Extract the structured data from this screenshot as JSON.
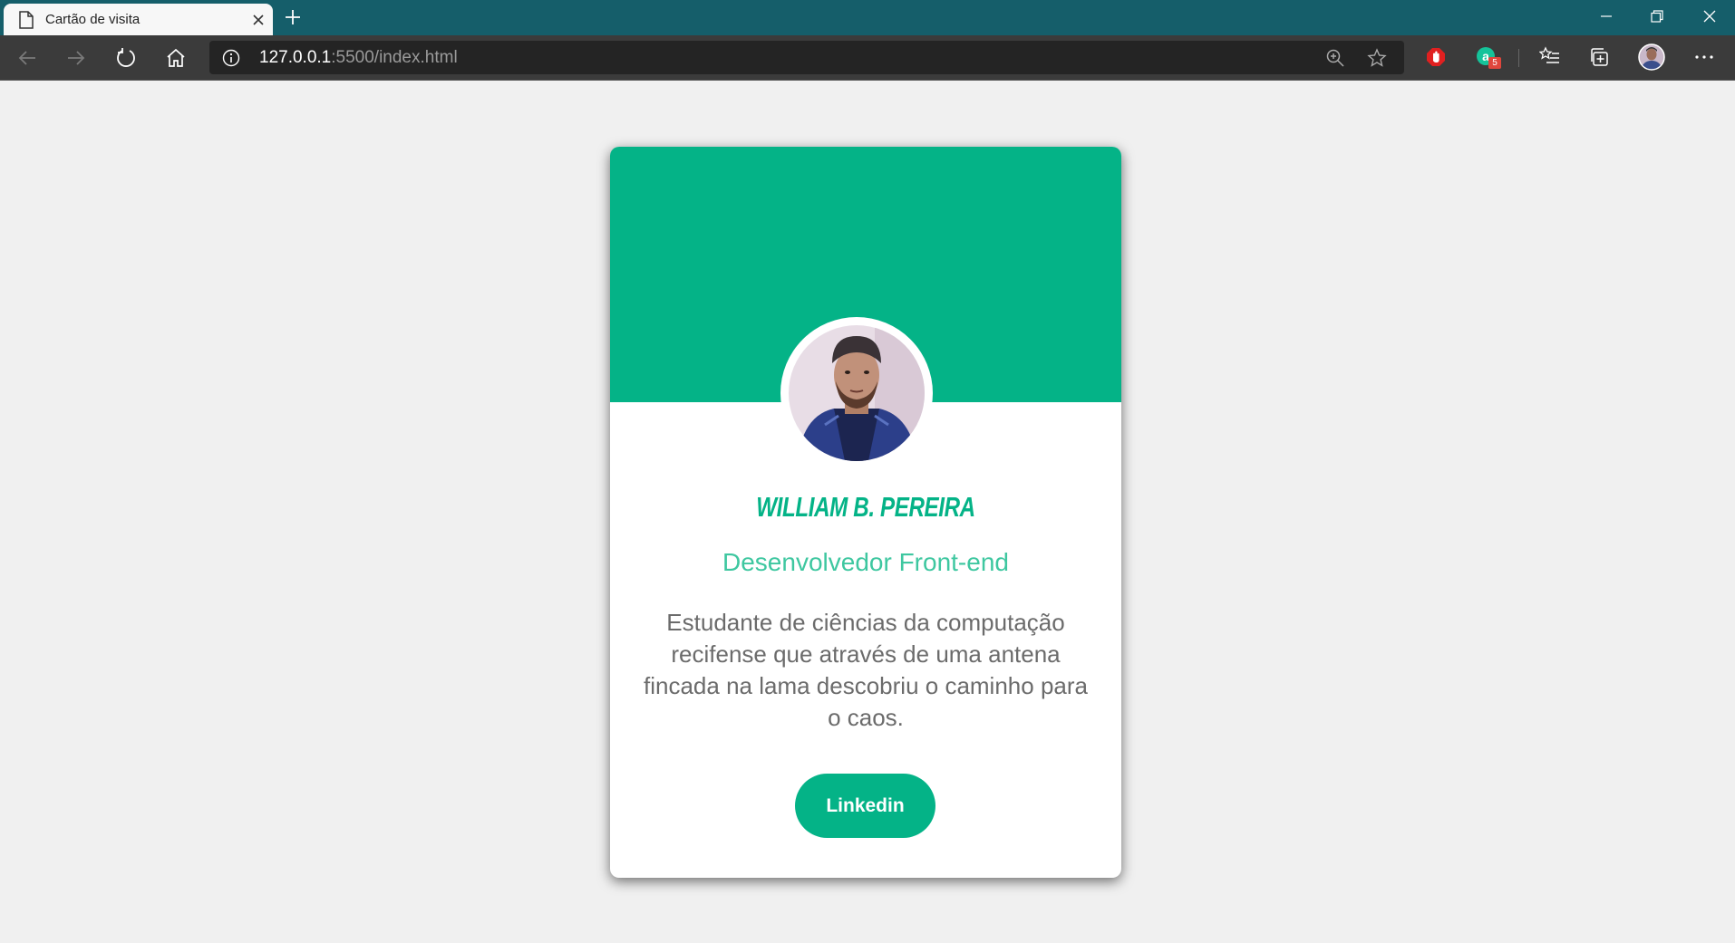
{
  "browser": {
    "tab_title": "Cartão de visita",
    "url_host": "127.0.0.1",
    "url_rest": ":5500/index.html",
    "extension_badge": "5",
    "colors": {
      "tabstrip": "#155e6a",
      "toolbar": "#3b3b3b",
      "addressbar": "#242424"
    }
  },
  "card": {
    "name": "WILLIAM B. PEREIRA",
    "role": "Desenvolvedor Front-end",
    "bio": "Estudante de ciências da computação recifense que através de uma antena fincada na lama descobriu o caminho para o caos.",
    "button_label": "Linkedin",
    "accent_color": "#04b387"
  }
}
